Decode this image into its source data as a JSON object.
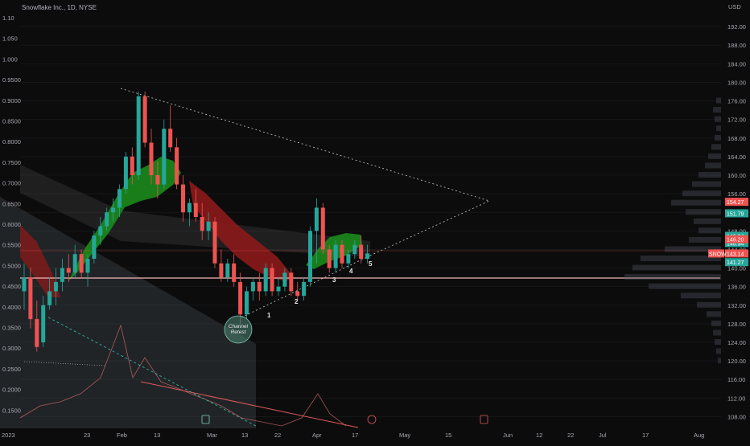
{
  "header": {
    "symbol_title": "Snowflake Inc., 1D, NYSE"
  },
  "annotations": {
    "channel_retest_line1": "Channel",
    "channel_retest_line2": "Retest",
    "wave_labels": [
      "1",
      "2",
      "3",
      "4",
      "5"
    ]
  },
  "colors": {
    "background": "#0c0c0d",
    "up_candle": "#26a69a",
    "down_candle": "#ef5350",
    "cloud_green": "#1b8a1b",
    "cloud_red": "#8b1a1a",
    "horizontal_line": "#f7b5b5"
  },
  "chart_data": {
    "type": "candlestick",
    "title": "Snowflake Inc., 1D, NYSE",
    "right_axis": {
      "unit": "USD",
      "ticks": [
        "192.00",
        "188.00",
        "184.00",
        "180.00",
        "176.00",
        "172.00",
        "168.00",
        "164.00",
        "160.00",
        "156.00",
        "152.00",
        "148.00",
        "144.00",
        "140.00",
        "136.00",
        "132.00",
        "128.00",
        "124.00",
        "120.00",
        "116.00",
        "112.00",
        "108.00"
      ],
      "range": [
        106,
        196
      ]
    },
    "left_axis": {
      "ticks": [
        "1.10",
        "1.050",
        "1.000",
        "0.9500",
        "0.9000",
        "0.8500",
        "0.8000",
        "0.7500",
        "0.7000",
        "0.6500",
        "0.6000",
        "0.5500",
        "0.5000",
        "0.4500",
        "0.4000",
        "0.3500",
        "0.3000",
        "0.2500",
        "0.2000",
        "0.1500"
      ]
    },
    "x_axis": {
      "ticks": [
        "2023",
        "23",
        "Feb",
        "13",
        "Mar",
        "13",
        "22",
        "Apr",
        "17",
        "May",
        "15",
        "Jun",
        "12",
        "22",
        "Jul",
        "17",
        "Aug"
      ]
    },
    "price_badges": [
      {
        "label": "154.27",
        "value": 154.27,
        "color": "#ef5350"
      },
      {
        "label": "151.79",
        "value": 151.79,
        "color": "#26a69a"
      },
      {
        "label": "146.94",
        "value": 146.94,
        "color": "#26a69a"
      },
      {
        "label": "146.94",
        "value": 146.94,
        "color": "#26a69a"
      },
      {
        "label": "146.20",
        "value": 146.2,
        "color": "#ef5350"
      },
      {
        "label": "143.14",
        "value": 143.14,
        "color": "#ef5350"
      },
      {
        "label": "141.27",
        "value": 141.27,
        "color": "#26a69a"
      }
    ],
    "badge_tag": "SNOW",
    "candles": [
      {
        "o": 135,
        "h": 141,
        "l": 131,
        "c": 138
      },
      {
        "o": 138,
        "h": 140,
        "l": 127,
        "c": 129
      },
      {
        "o": 129,
        "h": 133,
        "l": 122,
        "c": 123
      },
      {
        "o": 124,
        "h": 134,
        "l": 123,
        "c": 132
      },
      {
        "o": 132,
        "h": 138,
        "l": 131,
        "c": 135
      },
      {
        "o": 135,
        "h": 140,
        "l": 132,
        "c": 137
      },
      {
        "o": 137,
        "h": 142,
        "l": 135,
        "c": 140
      },
      {
        "o": 140,
        "h": 143,
        "l": 137,
        "c": 139
      },
      {
        "o": 139,
        "h": 145,
        "l": 138,
        "c": 143
      },
      {
        "o": 143,
        "h": 144,
        "l": 138,
        "c": 139
      },
      {
        "o": 139,
        "h": 143,
        "l": 136,
        "c": 142
      },
      {
        "o": 142,
        "h": 148,
        "l": 141,
        "c": 147
      },
      {
        "o": 147,
        "h": 151,
        "l": 145,
        "c": 149
      },
      {
        "o": 149,
        "h": 153,
        "l": 148,
        "c": 152
      },
      {
        "o": 152,
        "h": 155,
        "l": 150,
        "c": 153
      },
      {
        "o": 153,
        "h": 158,
        "l": 151,
        "c": 157
      },
      {
        "o": 157,
        "h": 165,
        "l": 156,
        "c": 164
      },
      {
        "o": 164,
        "h": 166,
        "l": 158,
        "c": 160
      },
      {
        "o": 160,
        "h": 178,
        "l": 159,
        "c": 177
      },
      {
        "o": 177,
        "h": 178,
        "l": 166,
        "c": 167
      },
      {
        "o": 167,
        "h": 170,
        "l": 158,
        "c": 160
      },
      {
        "o": 160,
        "h": 163,
        "l": 155,
        "c": 158
      },
      {
        "o": 158,
        "h": 172,
        "l": 157,
        "c": 170
      },
      {
        "o": 170,
        "h": 175,
        "l": 165,
        "c": 166
      },
      {
        "o": 166,
        "h": 168,
        "l": 157,
        "c": 158
      },
      {
        "o": 158,
        "h": 160,
        "l": 150,
        "c": 152
      },
      {
        "o": 152,
        "h": 155,
        "l": 149,
        "c": 154
      },
      {
        "o": 154,
        "h": 157,
        "l": 150,
        "c": 151
      },
      {
        "o": 151,
        "h": 154,
        "l": 146,
        "c": 148
      },
      {
        "o": 148,
        "h": 152,
        "l": 146,
        "c": 150
      },
      {
        "o": 150,
        "h": 151,
        "l": 140,
        "c": 141
      },
      {
        "o": 141,
        "h": 144,
        "l": 137,
        "c": 138
      },
      {
        "o": 138,
        "h": 142,
        "l": 137,
        "c": 141
      },
      {
        "o": 141,
        "h": 143,
        "l": 136,
        "c": 137
      },
      {
        "o": 137,
        "h": 139,
        "l": 128,
        "c": 130
      },
      {
        "o": 130,
        "h": 136,
        "l": 129,
        "c": 135
      },
      {
        "o": 135,
        "h": 138,
        "l": 133,
        "c": 137
      },
      {
        "o": 137,
        "h": 139,
        "l": 133,
        "c": 135
      },
      {
        "o": 135,
        "h": 141,
        "l": 134,
        "c": 140
      },
      {
        "o": 140,
        "h": 141,
        "l": 134,
        "c": 135
      },
      {
        "o": 135,
        "h": 138,
        "l": 134,
        "c": 136
      },
      {
        "o": 136,
        "h": 140,
        "l": 135,
        "c": 139
      },
      {
        "o": 139,
        "h": 140,
        "l": 134,
        "c": 135
      },
      {
        "o": 135,
        "h": 137,
        "l": 133,
        "c": 134
      },
      {
        "o": 134,
        "h": 138,
        "l": 133,
        "c": 137
      },
      {
        "o": 137,
        "h": 149,
        "l": 136,
        "c": 148
      },
      {
        "o": 148,
        "h": 155,
        "l": 141,
        "c": 153
      },
      {
        "o": 153,
        "h": 154,
        "l": 143,
        "c": 144
      },
      {
        "o": 144,
        "h": 145,
        "l": 139,
        "c": 140
      },
      {
        "o": 140,
        "h": 146,
        "l": 139,
        "c": 145
      },
      {
        "o": 145,
        "h": 146,
        "l": 140,
        "c": 141
      },
      {
        "o": 141,
        "h": 144,
        "l": 140,
        "c": 143
      },
      {
        "o": 143,
        "h": 146,
        "l": 142,
        "c": 145
      },
      {
        "o": 145,
        "h": 147,
        "l": 141,
        "c": 142
      },
      {
        "o": 142,
        "h": 145,
        "l": 141,
        "c": 143.14
      }
    ]
  }
}
